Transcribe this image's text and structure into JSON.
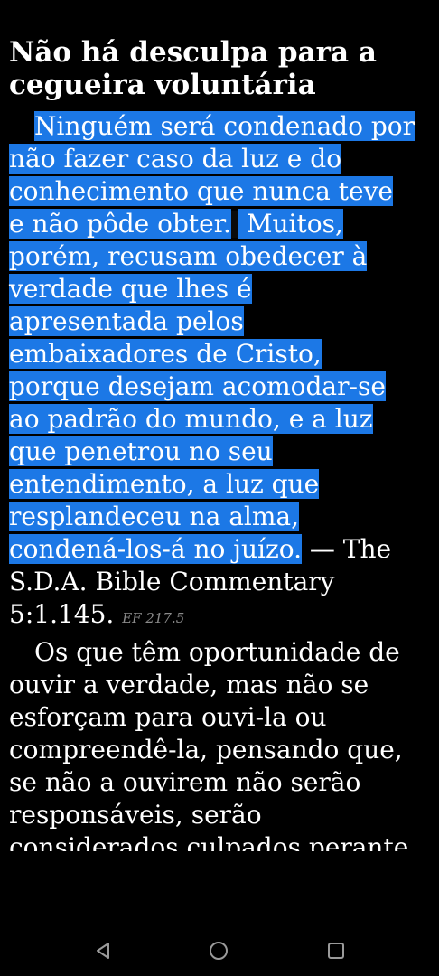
{
  "article": {
    "title": "Não há desculpa para a cegueira voluntária",
    "paragraph1_lines": [
      "Ninguém será condenado por",
      "não fazer caso da luz e do",
      "conhecimento que nunca teve",
      "e não pôde obter.",
      " Muitos,",
      "porém, recusam obedecer à",
      "verdade que lhes é",
      "apresentada pelos",
      "embaixadores de Cristo,",
      "porque desejam acomodar-se",
      "ao padrão do mundo, e a luz",
      "que penetrou no seu",
      "entendimento, a luz que",
      "resplandeceu na alma,",
      "condená-los-á no juízo.",
      " — The",
      "S.D.A. Bible Commentary",
      "5:1.145.",
      "EF 217.5"
    ],
    "paragraph2_lines": [
      "Os que têm oportunidade de",
      "ouvir a verdade, mas não se",
      "esforçam para ouvi-la ou",
      "compreendê-la, pensando que,",
      "se não a ouvirem não serão",
      "responsáveis, serão",
      "considerados culpados perante"
    ]
  },
  "colors": {
    "background": "#000000",
    "text": "#ffffff",
    "selection": "#1c78e6",
    "reference": "#8a8a8a"
  },
  "navbar": {
    "back_icon": "triangle-back-icon",
    "home_icon": "circle-home-icon",
    "recent_icon": "square-recent-apps-icon"
  }
}
